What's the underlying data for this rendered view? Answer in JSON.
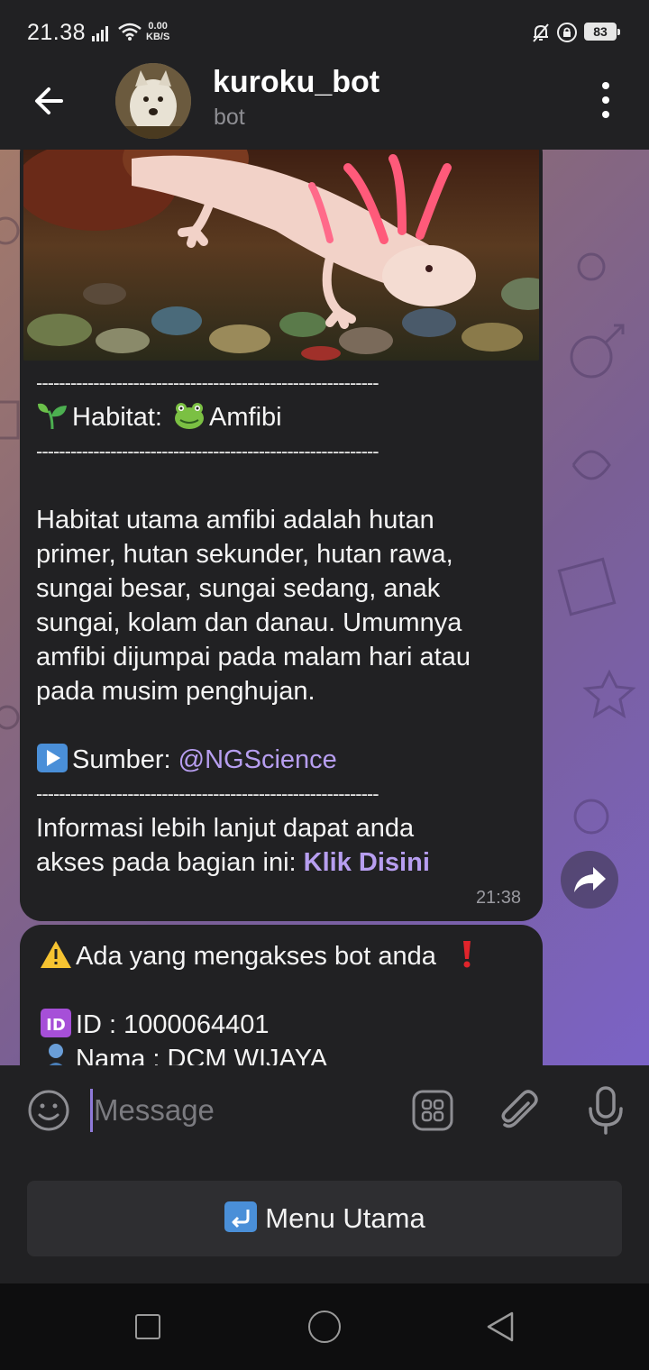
{
  "status_bar": {
    "time": "21.38",
    "net_speed": "0.00",
    "net_unit": "KB/S",
    "battery": "83"
  },
  "header": {
    "bot_name": "kuroku_bot",
    "subtitle": "bot"
  },
  "message1": {
    "divider": "------------------------------------------------------------",
    "habitat_label": "Habitat:",
    "habitat_value": "Amfibi",
    "para_lines": [
      "Habitat utama amfibi adalah hutan",
      "primer, hutan sekunder, hutan rawa,",
      "sungai besar, sungai sedang, anak",
      "sungai, kolam dan danau. Umumnya",
      "amfibi dijumpai pada malam hari atau",
      "pada musim penghujan."
    ],
    "source_label": "Sumber:",
    "source_link": "@NGScience",
    "info_line1": "Informasi lebih lanjut dapat anda",
    "info_line2": "akses pada bagian ini:",
    "info_link": "Klik Disini",
    "time": "21:38"
  },
  "message2": {
    "alert_text": "Ada yang mengakses bot anda",
    "id_text": "ID : 1000064401",
    "name_text": "Nama : DCM WIJAYA"
  },
  "input": {
    "placeholder": "Message"
  },
  "keyboard": {
    "menu_label": "Menu Utama"
  },
  "icons": {
    "back": "arrow-left-icon",
    "more": "more-vertical-icon",
    "share": "share-icon",
    "emoji": "smiley-icon",
    "commands": "grid-icon",
    "attach": "paperclip-icon",
    "mic": "microphone-icon"
  }
}
